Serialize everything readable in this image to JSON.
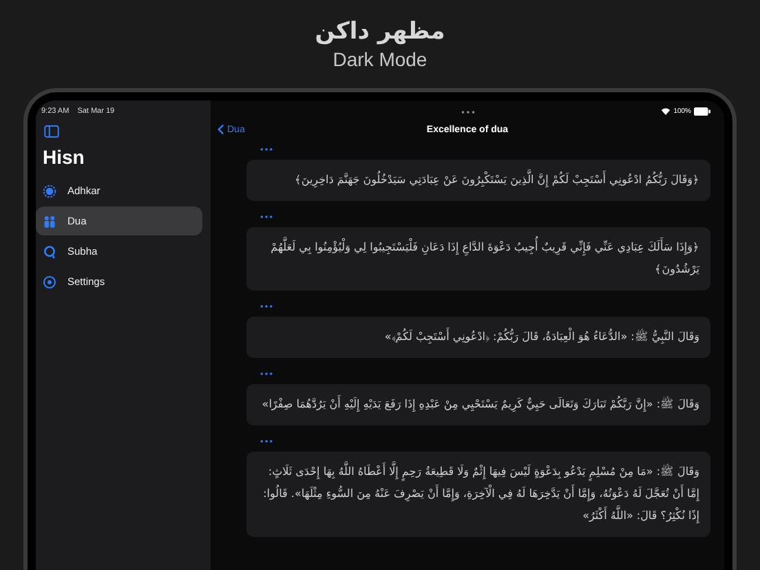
{
  "header": {
    "title": "مظهر داكن",
    "subtitle": "Dark Mode"
  },
  "status_bar": {
    "time": "9:23 AM",
    "date": "Sat Mar 19",
    "battery": "100%"
  },
  "sidebar": {
    "title": "Hisn",
    "items": [
      {
        "label": "Adhkar",
        "selected": false
      },
      {
        "label": "Dua",
        "selected": true
      },
      {
        "label": "Subha",
        "selected": false
      },
      {
        "label": "Settings",
        "selected": false
      }
    ]
  },
  "nav": {
    "back": "Dua",
    "title": "Excellence of dua"
  },
  "cards": [
    {
      "text": "﴿وَقَالَ رَبُّكُمُ ادْعُونِي أَسْتَجِبْ لَكُمْ إِنَّ الَّذِينَ يَسْتَكْبِرُونَ عَنْ عِبَادَتِي سَيَدْخُلُونَ جَهَنَّمَ دَاخِرِينَ﴾"
    },
    {
      "text": "﴿وَإِذَا سَأَلَكَ عِبَادِي عَنِّي فَإِنِّي قَرِيبٌ أُجِيبُ دَعْوَةَ الدَّاعِ إِذَا دَعَانِ فَلْيَسْتَجِيبُوا لِي وَلْيُؤْمِنُوا بِي لَعَلَّهُمْ يَرْشُدُونَ﴾"
    },
    {
      "text": "وَقَالَ النَّبِيُّ ﷺ: «الدُّعَاءُ هُوَ الْعِبَادَةُ، قَالَ رَبُّكُمْ: ﴿ادْعُونِي أَسْتَجِبْ لَكُمْ﴾»"
    },
    {
      "text": "وَقَالَ ﷺ: «إِنَّ رَبَّكُمْ تَبَارَكَ وَتَعَالَى حَيِيٌّ كَرِيمٌ يَسْتَحْيِي مِنْ عَبْدِهِ إِذَا رَفَعَ يَدَيْهِ إِلَيْهِ أَنْ يَرُدَّهُمَا صِفْرًا»"
    },
    {
      "text": "وَقَالَ ﷺ: «مَا مِنْ مُسْلِمٍ يَدْعُو بِدَعْوَةٍ لَيْسَ فِيهَا إِثْمٌ وَلَا قَطِيعَةُ رَحِمٍ إِلَّا أَعْطَاهُ اللَّهُ بِهَا إِحْدَى ثَلَاثٍ: إِمَّا أَنْ تُعَجَّلَ لَهُ دَعْوَتُهُ، وَإِمَّا أَنْ يَدَّخِرَهَا لَهُ فِي الْآخِرَةِ، وَإِمَّا أَنْ يَصْرِفَ عَنْهُ مِنَ السُّوءِ مِثْلَهَا». قَالُوا: إِذًا نُكْثِرُ؟ قَالَ: «اللَّهُ أَكْثَرُ»"
    }
  ]
}
